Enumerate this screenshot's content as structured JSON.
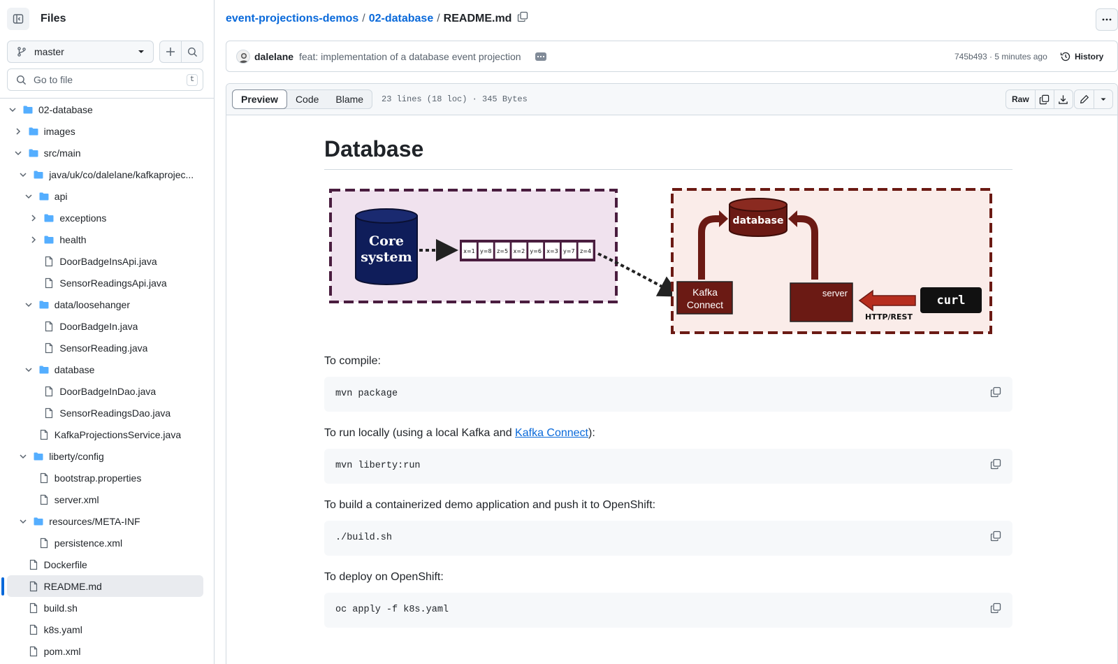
{
  "sidebar": {
    "title": "Files",
    "branch": "master",
    "search_placeholder": "Go to file",
    "search_shortcut": "t",
    "tree": [
      {
        "label": "02-database",
        "type": "folder",
        "depth": 0,
        "expanded": true
      },
      {
        "label": "images",
        "type": "folder",
        "depth": 1,
        "expanded": false
      },
      {
        "label": "src/main",
        "type": "folder",
        "depth": 1,
        "expanded": true
      },
      {
        "label": "java/uk/co/dalelane/kafkaprojec...",
        "type": "folder",
        "depth": 2,
        "expanded": true
      },
      {
        "label": "api",
        "type": "folder",
        "depth": 3,
        "expanded": true
      },
      {
        "label": "exceptions",
        "type": "folder",
        "depth": 4,
        "expanded": false
      },
      {
        "label": "health",
        "type": "folder",
        "depth": 4,
        "expanded": false
      },
      {
        "label": "DoorBadgeInsApi.java",
        "type": "file",
        "depth": 4
      },
      {
        "label": "SensorReadingsApi.java",
        "type": "file",
        "depth": 4
      },
      {
        "label": "data/loosehanger",
        "type": "folder",
        "depth": 3,
        "expanded": true
      },
      {
        "label": "DoorBadgeIn.java",
        "type": "file",
        "depth": 4
      },
      {
        "label": "SensorReading.java",
        "type": "file",
        "depth": 4
      },
      {
        "label": "database",
        "type": "folder",
        "depth": 3,
        "expanded": true
      },
      {
        "label": "DoorBadgeInDao.java",
        "type": "file",
        "depth": 4
      },
      {
        "label": "SensorReadingsDao.java",
        "type": "file",
        "depth": 4
      },
      {
        "label": "KafkaProjectionsService.java",
        "type": "file",
        "depth": 3
      },
      {
        "label": "liberty/config",
        "type": "folder",
        "depth": 2,
        "expanded": true
      },
      {
        "label": "bootstrap.properties",
        "type": "file",
        "depth": 3
      },
      {
        "label": "server.xml",
        "type": "file",
        "depth": 3
      },
      {
        "label": "resources/META-INF",
        "type": "folder",
        "depth": 2,
        "expanded": true
      },
      {
        "label": "persistence.xml",
        "type": "file",
        "depth": 3
      },
      {
        "label": "Dockerfile",
        "type": "file",
        "depth": 1
      },
      {
        "label": "README.md",
        "type": "file",
        "depth": 1,
        "active": true
      },
      {
        "label": "build.sh",
        "type": "file",
        "depth": 1
      },
      {
        "label": "k8s.yaml",
        "type": "file",
        "depth": 1
      },
      {
        "label": "pom.xml",
        "type": "file",
        "depth": 1
      }
    ]
  },
  "breadcrumb": {
    "repo": "event-projections-demos",
    "folder": "02-database",
    "file": "README.md",
    "sep": "/"
  },
  "commit": {
    "author": "dalelane",
    "message": "feat: implementation of a database event projection",
    "meta": "745b493 · 5 minutes ago",
    "history_label": "History"
  },
  "file_header": {
    "tabs": [
      "Preview",
      "Code",
      "Blame"
    ],
    "active_tab": "Preview",
    "stats": "23 lines (18 loc) · 345 Bytes",
    "raw_label": "Raw"
  },
  "readme": {
    "title": "Database",
    "diagram": {
      "core_system": [
        "Core",
        "system"
      ],
      "events": [
        "x=1",
        "y=8",
        "z=5",
        "x=2",
        "y=6",
        "x=3",
        "y=7",
        "z=4"
      ],
      "database": "database",
      "kafka_connect": [
        "Kafka",
        "Connect"
      ],
      "server": "server",
      "curl": "curl",
      "http_label": "HTTP/REST"
    },
    "compile_text": "To compile:",
    "compile_cmd": "mvn package",
    "run_text_pre": "To run locally (using a local Kafka and ",
    "run_link": "Kafka Connect",
    "run_text_post": "):",
    "run_cmd": "mvn liberty:run",
    "build_text": "To build a containerized demo application and push it to OpenShift:",
    "build_cmd": "./build.sh",
    "deploy_text": "To deploy on OpenShift:",
    "deploy_cmd": "oc apply -f k8s.yaml"
  },
  "colors": {
    "accent": "#0969da",
    "left_panel_fill": "#f0e2ee",
    "left_panel_border": "#4a1d3f",
    "right_panel_fill": "#faece9",
    "right_panel_border": "#6b1a14",
    "core_fill": "#0f1d5a",
    "db_fill": "#6b1a14",
    "arrow_fill": "#b62d1e"
  }
}
